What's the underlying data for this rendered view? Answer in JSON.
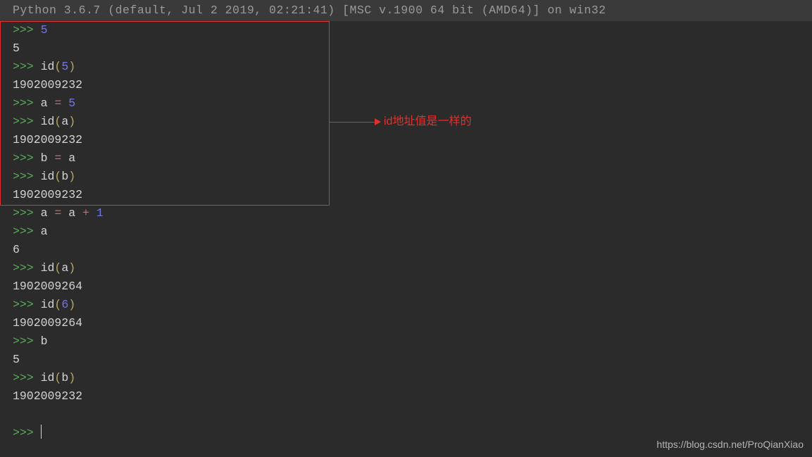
{
  "header": "Python 3.6.7 (default, Jul  2 2019, 02:21:41) [MSC v.1900 64 bit (AMD64)] on win32",
  "prompt": ">>> ",
  "lines": {
    "l1_num": "5",
    "l2_out": "5",
    "l3_func": "id",
    "l3_arg": "5",
    "l4_out": "1902009232",
    "l5_var": "a",
    "l5_eq": " = ",
    "l5_val": "5",
    "l6_func": "id",
    "l6_arg": "a",
    "l7_out": "1902009232",
    "l8_var": "b",
    "l8_eq": " = ",
    "l8_val": "a",
    "l9_func": "id",
    "l9_arg": "b",
    "l10_out": "1902009232",
    "l11_lhs": "a",
    "l11_eq": " = ",
    "l11_rhs1": "a",
    "l11_plus": " + ",
    "l11_rhs2": "1",
    "l12_expr": "a",
    "l13_out": "6",
    "l14_func": "id",
    "l14_arg": "a",
    "l15_out": "1902009264",
    "l16_func": "id",
    "l16_arg": "6",
    "l17_out": "1902009264",
    "l18_expr": "b",
    "l19_out": "5",
    "l20_func": "id",
    "l20_arg": "b",
    "l21_out": "1902009232"
  },
  "paren_open": "(",
  "paren_close": ")",
  "annotation": "id地址值是一样的",
  "watermark": "https://blog.csdn.net/ProQianXiao"
}
